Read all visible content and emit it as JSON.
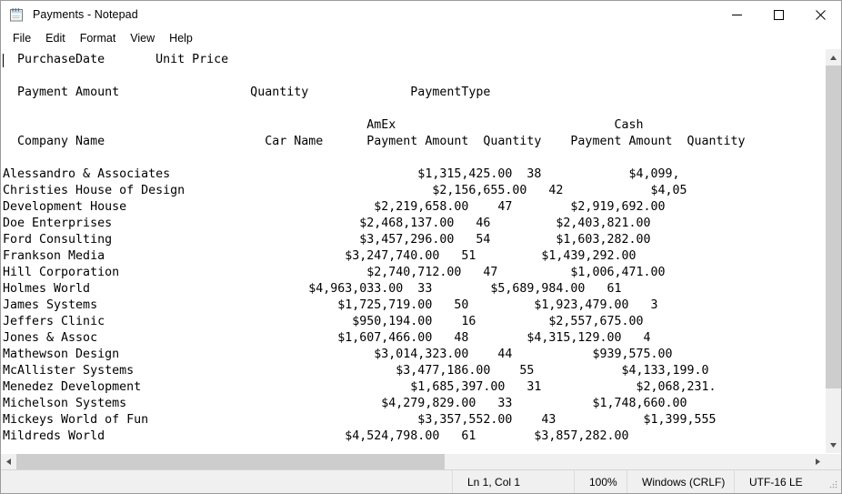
{
  "window": {
    "title": "Payments - Notepad",
    "icon": "notepad-icon",
    "controls": {
      "minimize": "—",
      "maximize": "□",
      "close": "✕"
    }
  },
  "menu": {
    "items": [
      {
        "label": "File"
      },
      {
        "label": "Edit"
      },
      {
        "label": "Format"
      },
      {
        "label": "View"
      },
      {
        "label": "Help"
      }
    ]
  },
  "document": {
    "headers": {
      "purchase_date": "PurchaseDate",
      "unit_price": "Unit Price",
      "payment_amount": "Payment Amount",
      "quantity": "Quantity",
      "payment_type": "PaymentType",
      "company_name": "Company Name",
      "car_name": "Car Name",
      "group_amex": "AmEx",
      "group_cash": "Cash",
      "sub_payment_amount": "Payment Amount",
      "sub_quantity": "Quantity"
    },
    "text": "  PurchaseDate       Unit Price\n\n  Payment Amount                  Quantity              PaymentType\n\n                                                  AmEx                              Cash\n  Company Name                      Car Name      Payment Amount  Quantity    Payment Amount  Quantity\n\nAlessandro & Associates                                  $1,315,425.00  38            $4,099,\nChristies House of Design                                  $2,156,655.00   42            $4,05\nDevelopment House                                  $2,219,658.00    47        $2,919,692.00\nDoe Enterprises                                  $2,468,137.00   46         $2,403,821.00\nFord Consulting                                  $3,457,296.00   54         $1,603,282.00\nFrankson Media                                 $3,247,740.00   51         $1,439,292.00\nHill Corporation                                  $2,740,712.00   47          $1,006,471.00\nHolmes World                              $4,963,033.00  33        $5,689,984.00   61\nJames Systems                                 $1,725,719.00   50         $1,923,479.00   3\nJeffers Clinic                                  $950,194.00    16          $2,557,675.00\nJones & Assoc                                 $1,607,466.00   48        $4,315,129.00   4\nMathewson Design                                   $3,014,323.00    44           $939,575.00\nMcAllister Systems                                    $3,477,186.00    55            $4,133,199.0\nMenedez Development                                     $1,685,397.00   31             $2,068,231.\nMichelson Systems                                   $4,279,829.00   33           $1,748,660.00\nMickeys World of Fun                                     $3,357,552.00    43            $1,399,555\nMildreds World                                 $4,524,798.00   61        $3,857,282.00",
    "rows": [
      {
        "company_name": "Alessandro & Associates",
        "amex_payment_amount": "$1,315,425.00",
        "amex_quantity": "38",
        "cash_payment_amount": "$4,099,",
        "cash_quantity": ""
      },
      {
        "company_name": "Christies House of Design",
        "amex_payment_amount": "$2,156,655.00",
        "amex_quantity": "42",
        "cash_payment_amount": "$4,05",
        "cash_quantity": ""
      },
      {
        "company_name": "Development House",
        "amex_payment_amount": "$2,219,658.00",
        "amex_quantity": "47",
        "cash_payment_amount": "$2,919,692.00",
        "cash_quantity": ""
      },
      {
        "company_name": "Doe Enterprises",
        "amex_payment_amount": "$2,468,137.00",
        "amex_quantity": "46",
        "cash_payment_amount": "$2,403,821.00",
        "cash_quantity": ""
      },
      {
        "company_name": "Ford Consulting",
        "amex_payment_amount": "$3,457,296.00",
        "amex_quantity": "54",
        "cash_payment_amount": "$1,603,282.00",
        "cash_quantity": ""
      },
      {
        "company_name": "Frankson Media",
        "amex_payment_amount": "$3,247,740.00",
        "amex_quantity": "51",
        "cash_payment_amount": "$1,439,292.00",
        "cash_quantity": ""
      },
      {
        "company_name": "Hill Corporation",
        "amex_payment_amount": "$2,740,712.00",
        "amex_quantity": "47",
        "cash_payment_amount": "$1,006,471.00",
        "cash_quantity": ""
      },
      {
        "company_name": "Holmes World",
        "amex_payment_amount": "$4,963,033.00",
        "amex_quantity": "33",
        "cash_payment_amount": "$5,689,984.00",
        "cash_quantity": "61"
      },
      {
        "company_name": "James Systems",
        "amex_payment_amount": "$1,725,719.00",
        "amex_quantity": "50",
        "cash_payment_amount": "$1,923,479.00",
        "cash_quantity": "3"
      },
      {
        "company_name": "Jeffers Clinic",
        "amex_payment_amount": "$950,194.00",
        "amex_quantity": "16",
        "cash_payment_amount": "$2,557,675.00",
        "cash_quantity": ""
      },
      {
        "company_name": "Jones & Assoc",
        "amex_payment_amount": "$1,607,466.00",
        "amex_quantity": "48",
        "cash_payment_amount": "$4,315,129.00",
        "cash_quantity": "4"
      },
      {
        "company_name": "Mathewson Design",
        "amex_payment_amount": "$3,014,323.00",
        "amex_quantity": "44",
        "cash_payment_amount": "$939,575.00",
        "cash_quantity": ""
      },
      {
        "company_name": "McAllister Systems",
        "amex_payment_amount": "$3,477,186.00",
        "amex_quantity": "55",
        "cash_payment_amount": "$4,133,199.0",
        "cash_quantity": ""
      },
      {
        "company_name": "Menedez Development",
        "amex_payment_amount": "$1,685,397.00",
        "amex_quantity": "31",
        "cash_payment_amount": "$2,068,231.",
        "cash_quantity": ""
      },
      {
        "company_name": "Michelson Systems",
        "amex_payment_amount": "$4,279,829.00",
        "amex_quantity": "33",
        "cash_payment_amount": "$1,748,660.00",
        "cash_quantity": ""
      },
      {
        "company_name": "Mickeys World of Fun",
        "amex_payment_amount": "$3,357,552.00",
        "amex_quantity": "43",
        "cash_payment_amount": "$1,399,555",
        "cash_quantity": ""
      },
      {
        "company_name": "Mildreds World",
        "amex_payment_amount": "$4,524,798.00",
        "amex_quantity": "61",
        "cash_payment_amount": "$3,857,282.00",
        "cash_quantity": ""
      }
    ]
  },
  "scrollbars": {
    "vertical": {
      "up": "▲",
      "down": "▼"
    },
    "horizontal": {
      "left": "◀",
      "right": "▶"
    }
  },
  "statusbar": {
    "line_col": "Ln 1, Col 1",
    "zoom": "100%",
    "line_ending": "Windows (CRLF)",
    "encoding": "UTF-16 LE"
  }
}
